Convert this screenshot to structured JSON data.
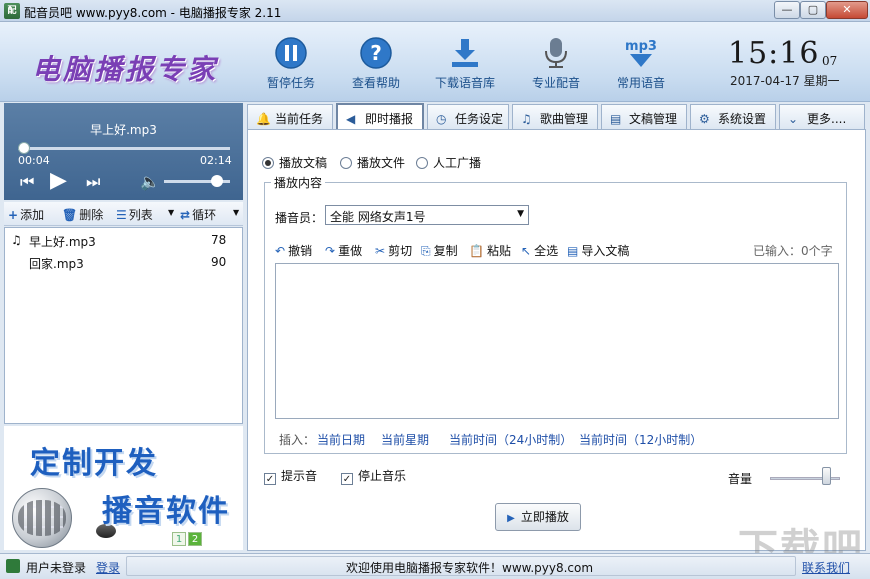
{
  "window": {
    "title": "配音员吧 www.pyy8.com - 电脑播报专家 2.11",
    "icon_text": "配",
    "buttons": {
      "minimize": "—",
      "maximize": "▢",
      "close": "✕"
    }
  },
  "header": {
    "logo": "电脑播报专家",
    "tools": [
      {
        "label": "暂停任务",
        "icon": "pause-icon"
      },
      {
        "label": "查看帮助",
        "icon": "help-icon"
      },
      {
        "label": "下载语音库",
        "icon": "download-icon"
      },
      {
        "label": "专业配音",
        "icon": "microphone-icon"
      },
      {
        "label": "常用语音",
        "icon": "mp3-icon"
      }
    ],
    "mp3_text": "mp3",
    "clock": {
      "time": "15:16",
      "seconds": "07",
      "date": "2017-04-17  星期一"
    }
  },
  "player": {
    "song": "早上好.mp3",
    "current_time": "00:04",
    "total_time": "02:14",
    "progress": 0.03,
    "volume": 0.8,
    "controls": {
      "prev": "⏮",
      "play": "▶",
      "next": "⏭",
      "volume": "🔈"
    }
  },
  "list_toolbar": {
    "add": "添加",
    "delete": "删除",
    "list": "列表",
    "loop": "循环",
    "icons": {
      "add": "+",
      "delete": "🗑",
      "list": "☰",
      "loop": "⇄",
      "drop": "▼"
    }
  },
  "playlist": [
    {
      "icon": "♫",
      "name": "早上好.mp3",
      "num": "78"
    },
    {
      "icon": "",
      "name": "回家.mp3",
      "num": "90"
    }
  ],
  "ad": {
    "line1": "定制开发",
    "line2": "播音软件",
    "pages": [
      "1",
      "2"
    ]
  },
  "tabs": [
    {
      "label": "当前任务",
      "icon": "🔔"
    },
    {
      "label": "即时播报",
      "icon": "◀"
    },
    {
      "label": "任务设定",
      "icon": "◷"
    },
    {
      "label": "歌曲管理",
      "icon": "♫"
    },
    {
      "label": "文稿管理",
      "icon": "▤"
    },
    {
      "label": "系统设置",
      "icon": "⚙"
    },
    {
      "label": "更多....",
      "icon": "⌄"
    }
  ],
  "content": {
    "radios": [
      {
        "label": "播放文稿",
        "checked": true
      },
      {
        "label": "播放文件",
        "checked": false
      },
      {
        "label": "人工广播",
        "checked": false
      }
    ],
    "group_title": "播放内容",
    "speaker_label": "播音员：",
    "speaker_value": "全能  网络女声1号",
    "edit_toolbar": [
      {
        "label": "撤销",
        "icon": "↶"
      },
      {
        "label": "重做",
        "icon": "↷"
      },
      {
        "label": "剪切",
        "icon": "✂"
      },
      {
        "label": "复制",
        "icon": "⎘"
      },
      {
        "label": "粘贴",
        "icon": "📋"
      },
      {
        "label": "全选",
        "icon": "↖"
      },
      {
        "label": "导入文稿",
        "icon": "▤"
      }
    ],
    "input_count": "已输入：0个字",
    "insert_label": "插入：",
    "insert_links": [
      "当前日期",
      "当前星期",
      "当前时间（24小时制）",
      "当前时间（12小时制）"
    ],
    "checkboxes": [
      {
        "label": "提示音",
        "checked": true
      },
      {
        "label": "停止音乐",
        "checked": true
      }
    ],
    "volume_label": "音量",
    "play_button": "立即播放",
    "play_icon": "▶"
  },
  "watermark": "下载吧",
  "status": {
    "user": "用户未登录",
    "login": "登录",
    "welcome": "欢迎使用电脑播报专家软件！www.pyy8.com",
    "contact": "联系我们"
  }
}
